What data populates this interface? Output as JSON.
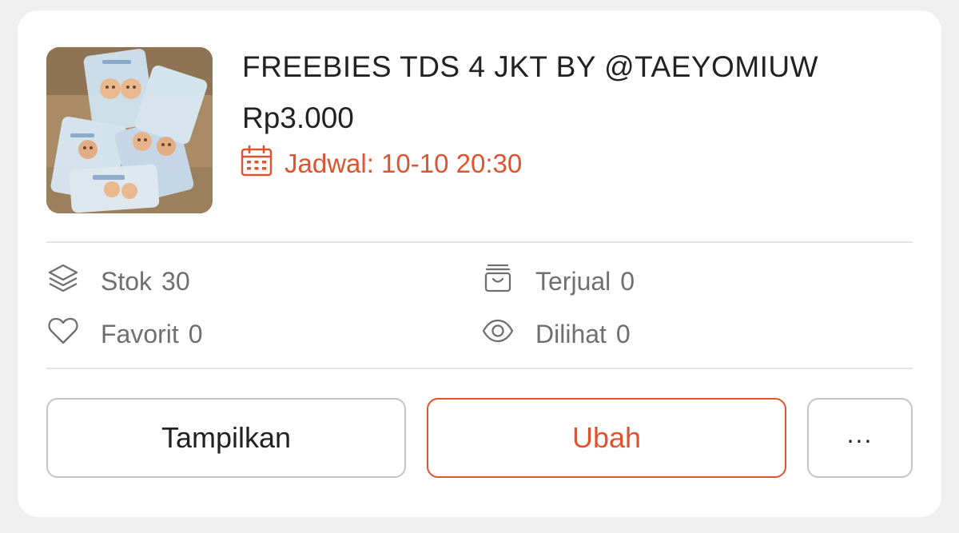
{
  "product": {
    "title": "FREEBIES TDS 4 JKT BY @TAEYOMIUW",
    "price": "Rp3.000",
    "schedule_label": "Jadwal: 10-10 20:30",
    "thumbnail_icon": "product-photo"
  },
  "stats": {
    "stock_label": "Stok",
    "stock_value": "30",
    "sold_label": "Terjual",
    "sold_value": "0",
    "favorite_label": "Favorit",
    "favorite_value": "0",
    "views_label": "Dilihat",
    "views_value": "0"
  },
  "actions": {
    "show_label": "Tampilkan",
    "edit_label": "Ubah",
    "more_label": "..."
  },
  "colors": {
    "accent": "#e0532f",
    "text": "#222222",
    "muted": "#6f6f6f",
    "border": "#c4c4c4",
    "background": "#efefef"
  }
}
